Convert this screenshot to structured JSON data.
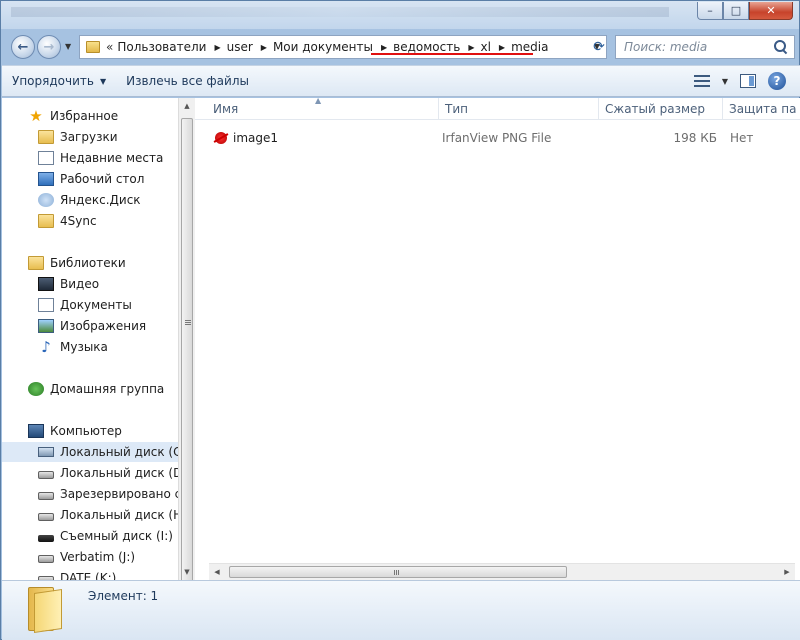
{
  "titlebar": {
    "minimize": "–",
    "maximize": "□",
    "close": "✕"
  },
  "nav": {
    "back": "←",
    "forward": "→"
  },
  "address": {
    "overflow_chevron": "«",
    "crumbs": [
      "Пользователи",
      "user",
      "Мои документы",
      "ведомость",
      "xl",
      "media"
    ]
  },
  "search": {
    "placeholder": "Поиск: media"
  },
  "toolbar": {
    "organize": "Упорядочить",
    "extract": "Извлечь все файлы"
  },
  "sidebar": {
    "favorites": "Избранное",
    "fav_items": [
      "Загрузки",
      "Недавние места",
      "Рабочий стол",
      "Яндекс.Диск",
      "4Sync"
    ],
    "libraries": "Библиотеки",
    "lib_items": [
      "Видео",
      "Документы",
      "Изображения",
      "Музыка"
    ],
    "homegroup": "Домашняя группа",
    "computer": "Компьютер",
    "drives": [
      "Локальный диск (C:)",
      "Локальный диск (D:)",
      "Зарезервировано си",
      "Локальный диск (H:)",
      "Съемный диск (I:)",
      "Verbatim (J:)",
      "DATE (K:)"
    ]
  },
  "columns": [
    "Имя",
    "Тип",
    "Сжатый размер",
    "Защита па"
  ],
  "files": [
    {
      "name": "image1",
      "type": "IrfanView PNG File",
      "size": "198 КБ",
      "protected": "Нет"
    }
  ],
  "details": {
    "status": "Элемент: 1"
  }
}
